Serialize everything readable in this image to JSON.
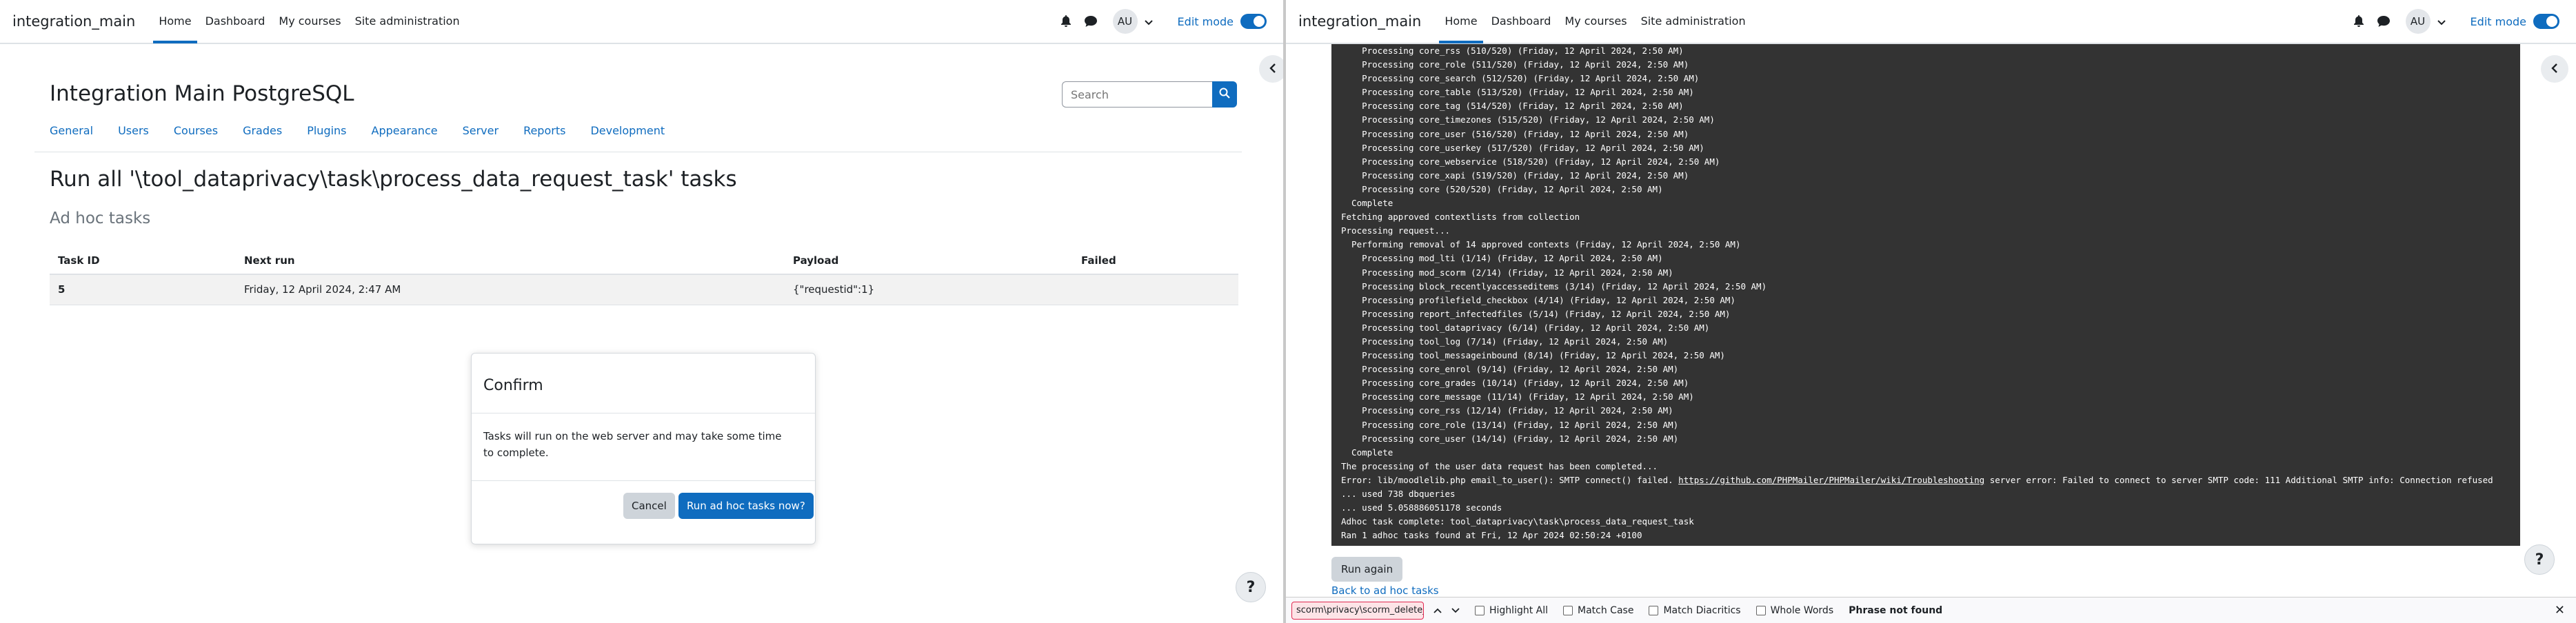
{
  "left": {
    "navbar": {
      "brand": "integration_main",
      "links": [
        "Home",
        "Dashboard",
        "My courses",
        "Site administration"
      ],
      "avatar": "AU",
      "edit_mode_label": "Edit mode"
    },
    "site_title": "Integration Main PostgreSQL",
    "search": {
      "placeholder": "Search"
    },
    "secondary_nav": [
      "General",
      "Users",
      "Courses",
      "Grades",
      "Plugins",
      "Appearance",
      "Server",
      "Reports",
      "Development"
    ],
    "page_heading": "Run all '\\tool_dataprivacy\\task\\process_data_request_task' tasks",
    "sub_heading": "Ad hoc tasks",
    "table": {
      "headers": [
        "Task ID",
        "Next run",
        "Payload",
        "Failed"
      ],
      "rows": [
        [
          "5",
          "Friday, 12 April 2024, 2:47 AM",
          "{\"requestid\":1}",
          ""
        ]
      ]
    },
    "modal": {
      "title": "Confirm",
      "body": "Tasks will run on the web server and may take some time to complete.",
      "cancel_label": "Cancel",
      "run_label": "Run ad hoc tasks now?"
    },
    "help": "?"
  },
  "right": {
    "navbar": {
      "brand": "integration_main",
      "links": [
        "Home",
        "Dashboard",
        "My courses",
        "Site administration"
      ],
      "avatar": "AU",
      "edit_mode_label": "Edit mode"
    },
    "console_lines": [
      "    Processing core_rss (510/520) (Friday, 12 April 2024, 2:50 AM)",
      "    Processing core_role (511/520) (Friday, 12 April 2024, 2:50 AM)",
      "    Processing core_search (512/520) (Friday, 12 April 2024, 2:50 AM)",
      "    Processing core_table (513/520) (Friday, 12 April 2024, 2:50 AM)",
      "    Processing core_tag (514/520) (Friday, 12 April 2024, 2:50 AM)",
      "    Processing core_timezones (515/520) (Friday, 12 April 2024, 2:50 AM)",
      "    Processing core_user (516/520) (Friday, 12 April 2024, 2:50 AM)",
      "    Processing core_userkey (517/520) (Friday, 12 April 2024, 2:50 AM)",
      "    Processing core_webservice (518/520) (Friday, 12 April 2024, 2:50 AM)",
      "    Processing core_xapi (519/520) (Friday, 12 April 2024, 2:50 AM)",
      "    Processing core (520/520) (Friday, 12 April 2024, 2:50 AM)",
      "  Complete",
      "Fetching approved contextlists from collection",
      "Processing request...",
      "  Performing removal of 14 approved contexts (Friday, 12 April 2024, 2:50 AM)",
      "    Processing mod_lti (1/14) (Friday, 12 April 2024, 2:50 AM)",
      "    Processing mod_scorm (2/14) (Friday, 12 April 2024, 2:50 AM)",
      "    Processing block_recentlyaccesseditems (3/14) (Friday, 12 April 2024, 2:50 AM)",
      "    Processing profilefield_checkbox (4/14) (Friday, 12 April 2024, 2:50 AM)",
      "    Processing report_infectedfiles (5/14) (Friday, 12 April 2024, 2:50 AM)",
      "    Processing tool_dataprivacy (6/14) (Friday, 12 April 2024, 2:50 AM)",
      "    Processing tool_log (7/14) (Friday, 12 April 2024, 2:50 AM)",
      "    Processing tool_messageinbound (8/14) (Friday, 12 April 2024, 2:50 AM)",
      "    Processing core_enrol (9/14) (Friday, 12 April 2024, 2:50 AM)",
      "    Processing core_grades (10/14) (Friday, 12 April 2024, 2:50 AM)",
      "    Processing core_message (11/14) (Friday, 12 April 2024, 2:50 AM)",
      "    Processing core_rss (12/14) (Friday, 12 April 2024, 2:50 AM)",
      "    Processing core_role (13/14) (Friday, 12 April 2024, 2:50 AM)",
      "    Processing core_user (14/14) (Friday, 12 April 2024, 2:50 AM)",
      "  Complete",
      "The processing of the user data request has been completed..."
    ],
    "console_error": {
      "prefix": "Error: lib/moodlelib.php email_to_user(): SMTP connect() failed. ",
      "link": "https://github.com/PHPMailer/PHPMailer/wiki/Troubleshooting",
      "suffix": " server error: Failed to connect to server SMTP code: 111 Additional SMTP info: Connection refused"
    },
    "console_tail": [
      "... used 738 dbqueries",
      "... used 5.058886051178 seconds",
      "Adhoc task complete: tool_dataprivacy\\task\\process_data_request_task",
      "Ran 1 adhoc tasks found at Fri, 12 Apr 2024 02:50:24 +0100"
    ],
    "run_again_label": "Run again",
    "back_link": "Back to ad hoc tasks",
    "help": "?"
  },
  "findbar": {
    "query": "scorm\\privacy\\scorm_delete_tracks()",
    "options": [
      "Highlight All",
      "Match Case",
      "Match Diacritics",
      "Whole Words"
    ],
    "status": "Phrase not found"
  },
  "colors": {
    "primary": "#0f6cbf",
    "console_bg": "#333333",
    "find_error": "#e22850"
  }
}
